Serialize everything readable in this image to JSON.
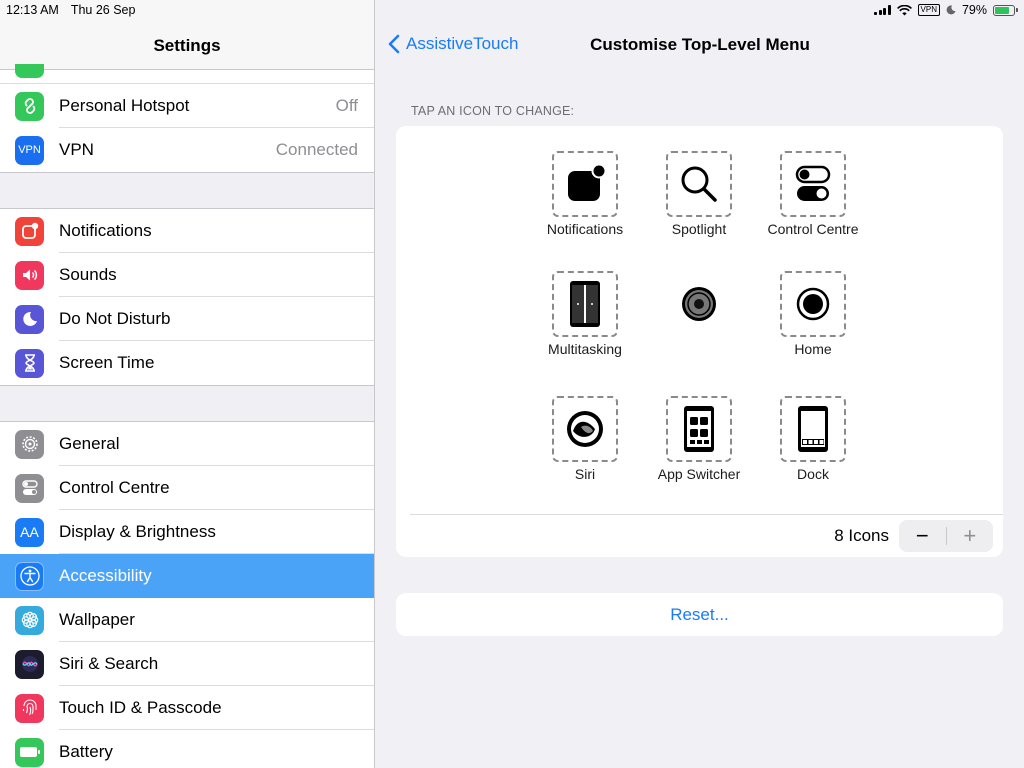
{
  "status": {
    "time": "12:13 AM",
    "date": "Thu 26 Sep",
    "vpn": "VPN",
    "battery": "79%"
  },
  "sidebar": {
    "title": "Settings",
    "group1": [
      {
        "label": "Personal Hotspot",
        "value": "Off",
        "color": "#34c759",
        "icon": "hotspot-icon"
      },
      {
        "label": "VPN",
        "value": "Connected",
        "color": "#1a6ff0",
        "icon": "vpn-icon",
        "icon_text": "VPN"
      }
    ],
    "group2": [
      {
        "label": "Notifications",
        "color": "#f0433a",
        "icon": "notifications-icon"
      },
      {
        "label": "Sounds",
        "color": "#f0385f",
        "icon": "sounds-icon"
      },
      {
        "label": "Do Not Disturb",
        "color": "#5856d6",
        "icon": "moon-icon"
      },
      {
        "label": "Screen Time",
        "color": "#5856d6",
        "icon": "hourglass-icon"
      }
    ],
    "group3": [
      {
        "label": "General",
        "color": "#8e8e93",
        "icon": "gear-icon"
      },
      {
        "label": "Control Centre",
        "color": "#8e8e93",
        "icon": "toggles-icon"
      },
      {
        "label": "Display & Brightness",
        "color": "#1a7cf5",
        "icon": "text-size-icon",
        "icon_text": "AA"
      },
      {
        "label": "Accessibility",
        "color": "#1a7cf5",
        "icon": "accessibility-icon",
        "selected": true
      },
      {
        "label": "Wallpaper",
        "color": "#35aadc",
        "icon": "flower-icon"
      },
      {
        "label": "Siri & Search",
        "color": "#222222",
        "icon": "siri-icon"
      },
      {
        "label": "Touch ID & Passcode",
        "color": "#f0385f",
        "icon": "fingerprint-icon"
      },
      {
        "label": "Battery",
        "color": "#34c759",
        "icon": "battery-icon"
      }
    ]
  },
  "nav": {
    "back_label": "AssistiveTouch",
    "title": "Customise Top-Level Menu"
  },
  "section_header": "TAP AN ICON TO CHANGE:",
  "tiles": {
    "notifications": "Notifications",
    "spotlight": "Spotlight",
    "control_centre": "Control Centre",
    "multitasking": "Multitasking",
    "home": "Home",
    "siri": "Siri",
    "app_switcher": "App Switcher",
    "dock": "Dock"
  },
  "icon_count": "8 Icons",
  "stepper": {
    "minus": "−",
    "plus": "+"
  },
  "reset_label": "Reset..."
}
